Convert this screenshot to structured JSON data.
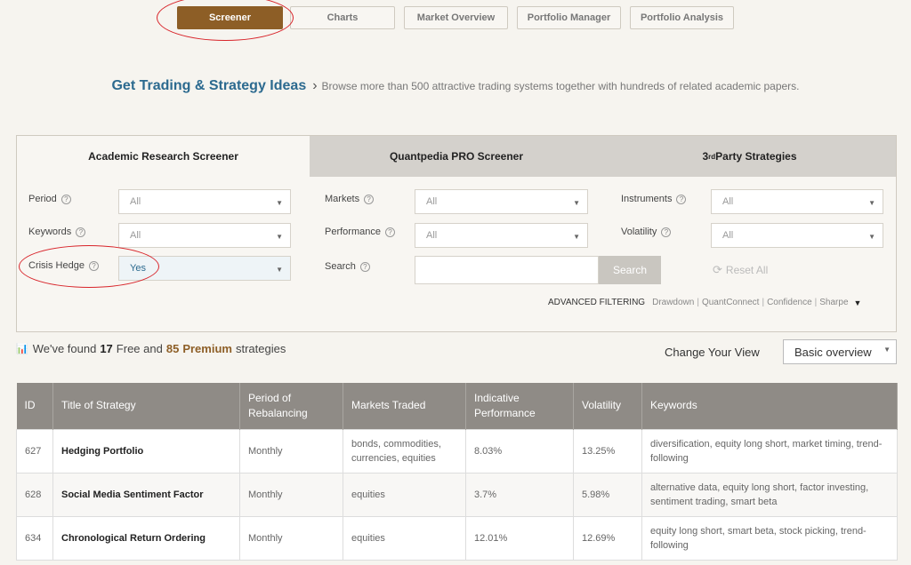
{
  "nav": {
    "items": [
      {
        "label": "Screener",
        "active": true
      },
      {
        "label": "Charts",
        "active": false
      },
      {
        "label": "Market Overview",
        "active": false
      },
      {
        "label": "Portfolio Manager",
        "active": false
      },
      {
        "label": "Portfolio Analysis",
        "active": false
      }
    ]
  },
  "hero": {
    "title": "Get Trading & Strategy Ideas",
    "subtitle": "Browse more than 500 attractive trading systems together with hundreds of related academic papers."
  },
  "tabs": {
    "academic": "Academic Research Screener",
    "pro": "Quantpedia PRO Screener",
    "third_prefix": "3",
    "third_sup": "rd",
    "third_suffix": " Party Strategies"
  },
  "filters": {
    "period": {
      "label": "Period",
      "value": "All"
    },
    "keywords": {
      "label": "Keywords",
      "value": "All"
    },
    "crisis_hedge": {
      "label": "Crisis Hedge",
      "value": "Yes"
    },
    "markets": {
      "label": "Markets",
      "value": "All"
    },
    "performance": {
      "label": "Performance",
      "value": "All"
    },
    "search": {
      "label": "Search",
      "value": ""
    },
    "instruments": {
      "label": "Instruments",
      "value": "All"
    },
    "volatility": {
      "label": "Volatility",
      "value": "All"
    }
  },
  "actions": {
    "search": "Search",
    "reset": "Reset All",
    "help_glyph": "?"
  },
  "advanced": {
    "label": "ADVANCED FILTERING",
    "links": [
      "Drawdown",
      "QuantConnect",
      "Confidence",
      "Sharpe"
    ]
  },
  "results": {
    "prefix": "We've found",
    "free_count": "17",
    "free_word": "Free and",
    "premium_count": "85",
    "premium_word": "Premium",
    "suffix": "strategies"
  },
  "view": {
    "label": "Change Your View",
    "selected": "Basic overview"
  },
  "table": {
    "headers": [
      "ID",
      "Title of Strategy",
      "Period of Rebalancing",
      "Markets Traded",
      "Indicative Performance",
      "Volatility",
      "Keywords"
    ],
    "rows": [
      {
        "id": "627",
        "title": "Hedging Portfolio",
        "period": "Monthly",
        "markets": "bonds, commodities, currencies, equities",
        "performance": "8.03%",
        "volatility": "13.25%",
        "keywords": "diversification, equity long short, market timing, trend-following"
      },
      {
        "id": "628",
        "title": "Social Media Sentiment Factor",
        "period": "Monthly",
        "markets": "equities",
        "performance": "3.7%",
        "volatility": "5.98%",
        "keywords": "alternative data, equity long short, factor investing, sentiment trading, smart beta"
      },
      {
        "id": "634",
        "title": "Chronological Return Ordering",
        "period": "Monthly",
        "markets": "equities",
        "performance": "12.01%",
        "volatility": "12.69%",
        "keywords": "equity long short, smart beta, stock picking, trend-following"
      }
    ]
  },
  "colors": {
    "brand": "#8d5e26",
    "heading": "#2c6a8f",
    "annotation": "#d8242a"
  }
}
